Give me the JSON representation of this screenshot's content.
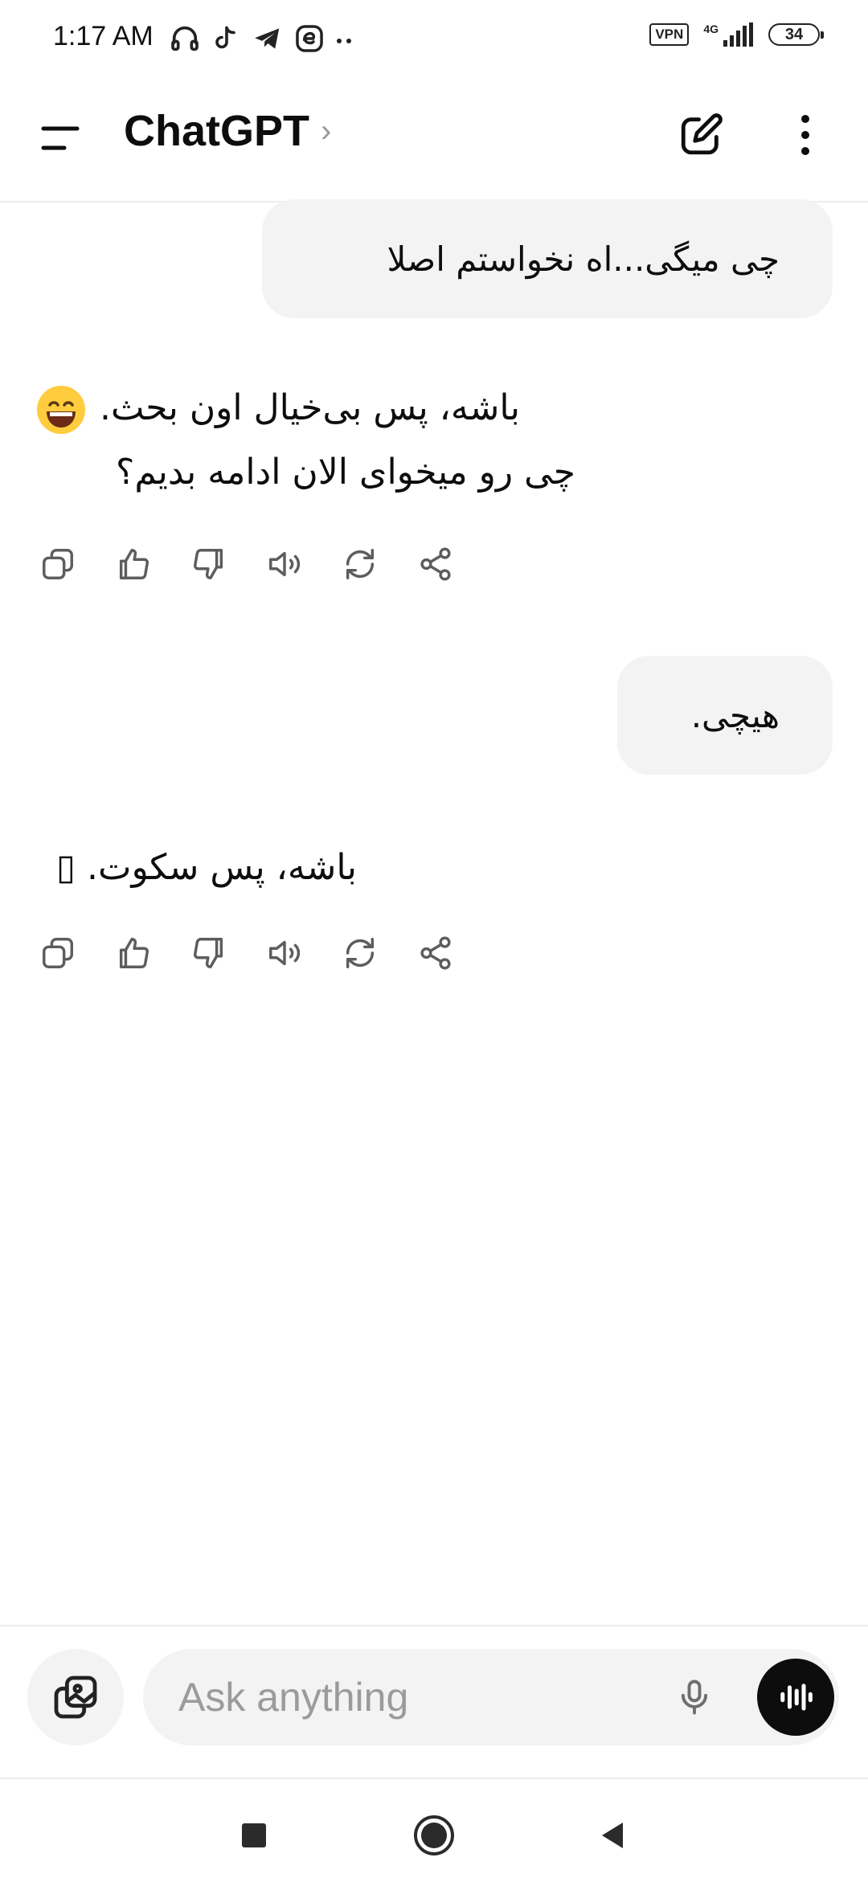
{
  "status_bar": {
    "time": "1:17 AM",
    "vpn": "VPN",
    "network": "4G",
    "battery": "34",
    "icons_left": [
      "headphones-icon",
      "tiktok-icon",
      "telegram-icon",
      "app-icon",
      "more-dots-icon"
    ]
  },
  "header": {
    "title": "ChatGPT",
    "chevron": "›",
    "icons": [
      "menu-icon",
      "edit-icon",
      "more-vertical-icon"
    ]
  },
  "messages": [
    {
      "role": "user",
      "text": "چی میگی...اه نخواستم اصلا"
    },
    {
      "role": "assistant",
      "lines": [
        "باشه، پس بی‌خیال اون بحث.",
        "چی رو میخوای الان ادامه بدیم؟"
      ],
      "emoji": "😄"
    },
    {
      "role": "user",
      "text": "هیچی."
    },
    {
      "role": "assistant",
      "lines": [
        "باشه، پس سکوت. ▯"
      ]
    }
  ],
  "message_actions": [
    "copy-icon",
    "thumbs-up-icon",
    "thumbs-down-icon",
    "read-aloud-icon",
    "regenerate-icon",
    "share-icon"
  ],
  "composer": {
    "placeholder": "Ask anything",
    "value": "",
    "icons": [
      "attach-image-icon",
      "microphone-icon",
      "voice-mode-icon"
    ]
  },
  "nav": {
    "icons": [
      "recents-icon",
      "home-icon",
      "back-icon"
    ]
  },
  "colors": {
    "bubble": "#f3f3f3",
    "text": "#0d0d0d",
    "muted_icon": "#5d5d5d",
    "voice_button": "#0d0d0d"
  }
}
